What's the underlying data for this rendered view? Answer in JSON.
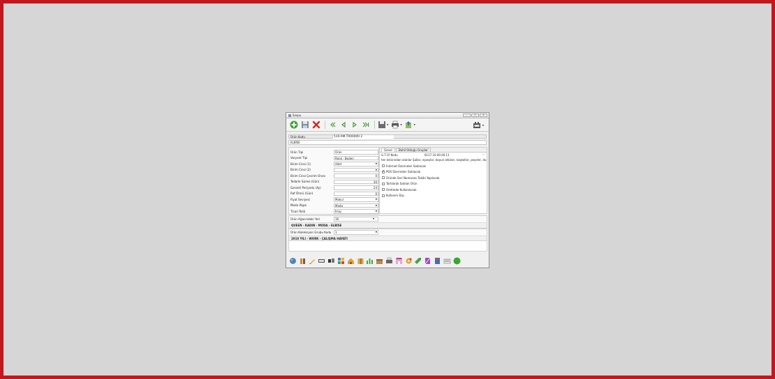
{
  "window": {
    "title": "Sınıpu"
  },
  "form": {
    "code_label": "Ürün Kodu",
    "code_value": "510-AM.TR00000 2",
    "description": "ELBİSE",
    "fields": [
      {
        "label": "Ürün Tipi",
        "value": "Ürün",
        "kind": "combo-dots"
      },
      {
        "label": "Varyant Tipi",
        "value": "Renk - Beden",
        "kind": "text"
      },
      {
        "label": "Birim Cinsi (1)",
        "value": "Adet",
        "kind": "select"
      },
      {
        "label": "Birim Cinsi (2)",
        "value": "",
        "kind": "select"
      },
      {
        "label": "Birim Cinsi Çevrim Oranı",
        "value": "0",
        "kind": "number"
      },
      {
        "label": "Tedarik Süresi (Gün)",
        "value": "30",
        "kind": "number"
      },
      {
        "label": "Garanti Periyodu (Ay)",
        "value": "24",
        "kind": "number"
      },
      {
        "label": "Raf Ömrü (Gün)",
        "value": "0",
        "kind": "number"
      },
      {
        "label": "Fiyat Seviyesi",
        "value": "Makul",
        "kind": "select"
      },
      {
        "label": "Moda Algısı",
        "value": "Moda",
        "kind": "select"
      },
      {
        "label": "Ticari Rolü",
        "value": "İmaj",
        "kind": "select"
      }
    ],
    "tree_label": "Ürün Ağacındaki Yeri",
    "tree_value": "16",
    "tree_path": "QUEEN - KADIN - MODA - ELBİSE",
    "collection_label": "Ürün Koleksiyon Grubu Kodu",
    "collection_value": "1",
    "collection_path": "2010 YILI - WORK - ÇALIŞMA HAYATI"
  },
  "tabs": [
    {
      "label": "Genel",
      "active": true
    },
    {
      "label": "Dahil Olduğu Gruplar",
      "active": false
    }
  ],
  "general": {
    "gtip_label": "G.T.İ.P Kodu",
    "gtip_value": "6117.10.00.00.11",
    "gtip_dots": "···",
    "note": "ten kıllarından olanlar Şallar, eşarplar, boyun atkıları, kaşkollar, peçeler, duvak",
    "checks": [
      {
        "label": "İnternet Üzerinden Satılacak",
        "checked": false
      },
      {
        "label": "POS Üzerinden Satılacak",
        "checked": true
      },
      {
        "label": "Üründe Seri Numarası Takibi Yapılacak",
        "checked": false
      },
      {
        "label": "Tartılarak Satılan Ürün",
        "checked": false
      },
      {
        "label": "Üretimde Kullanılacak",
        "checked": false
      },
      {
        "label": "Kullanım Dışı",
        "checked": false
      }
    ]
  },
  "colors": {
    "frame": "#c4161c",
    "background": "#d6d6d6"
  }
}
